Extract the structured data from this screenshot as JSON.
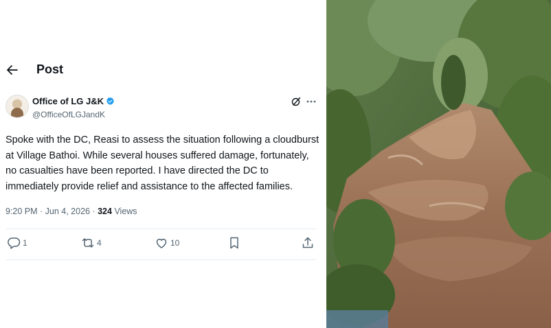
{
  "header": {
    "title": "Post"
  },
  "author": {
    "name": "Office of LG J&K",
    "handle": "@OfficeOfLGJandK"
  },
  "post": {
    "text": "Spoke with the DC, Reasi to assess the situation following a cloudburst at Village Bathoi. While several houses suffered damage, fortunately, no casualties have been reported. I have directed the DC to immediately provide relief and assistance to the affected families."
  },
  "meta": {
    "time_date": "9:20 PM · Jun 4, 2026 · ",
    "views_count": "324",
    "views_label": " Views"
  },
  "actions": {
    "replies": "1",
    "reposts": "4",
    "likes": "10"
  },
  "colors": {
    "verified": "#1d9bf0",
    "secondary_text": "#536471",
    "primary_text": "#0f1419",
    "divider": "#e6ecf0",
    "flood_water": "#9a7055",
    "forest": "#4d6b3c"
  },
  "icons": [
    "back-arrow-icon",
    "verified-badge-icon",
    "grok-icon",
    "more-icon",
    "reply-icon",
    "repost-icon",
    "like-icon",
    "bookmark-icon",
    "share-icon"
  ]
}
